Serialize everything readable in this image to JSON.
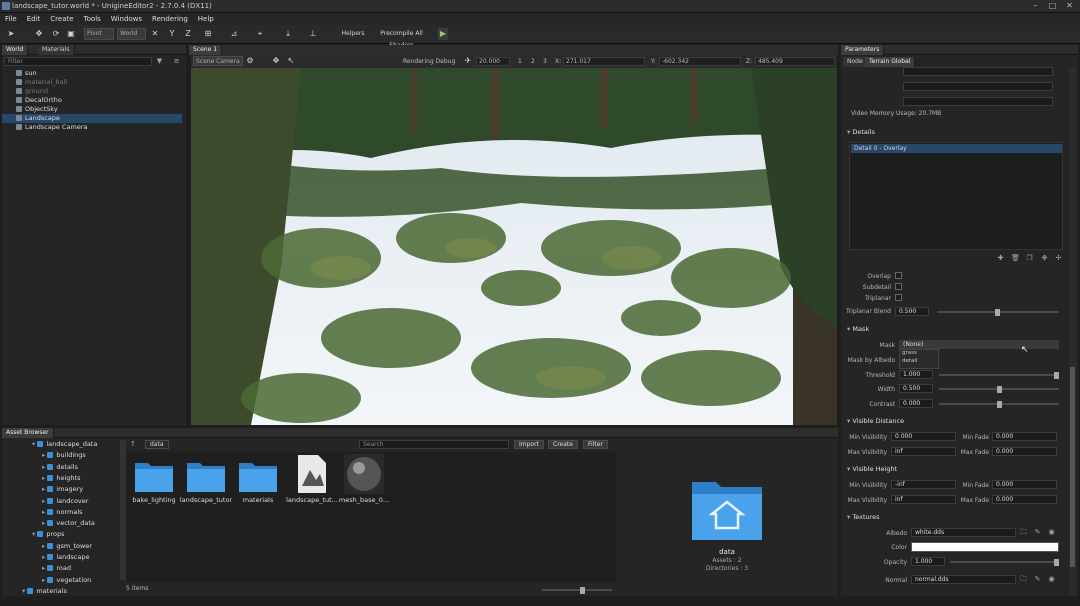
{
  "window": {
    "title": "landscape_tutor.world * - UnigineEditor2 - 2.7.0.4 (DX11)"
  },
  "menu": [
    "File",
    "Edit",
    "Create",
    "Tools",
    "Windows",
    "Rendering",
    "Help"
  ],
  "toolbar": {
    "pivot": "Pivot",
    "world": "World",
    "helpers": "Helpers",
    "precompile": "Precompile All Shaders"
  },
  "world_panel": {
    "tabs": [
      "World",
      "Materials"
    ],
    "filter_placeholder": "Filter",
    "nodes": [
      {
        "label": "sun",
        "dim": false
      },
      {
        "label": "material_ball",
        "dim": true
      },
      {
        "label": "ground",
        "dim": true
      },
      {
        "label": "DecalOrtho",
        "dim": false
      },
      {
        "label": "ObjectSky",
        "dim": false
      },
      {
        "label": "Landscape",
        "dim": false,
        "selected": true
      },
      {
        "label": "Landscape Camera",
        "dim": false
      }
    ]
  },
  "scene": {
    "tab": "Scene 1",
    "camera": "Scene Camera",
    "rendering_debug": "Rendering Debug",
    "speed": "20.000",
    "steps": [
      "1",
      "2",
      "3"
    ],
    "x_label": "X:",
    "x": "271.017",
    "y_label": "Y:",
    "y": "-602.342",
    "z_label": "Z:",
    "z": "485.409"
  },
  "asset_browser": {
    "tab": "Asset Browser",
    "tree": [
      {
        "label": "landscape_data",
        "level": 1
      },
      {
        "label": "buildings",
        "level": 2
      },
      {
        "label": "details",
        "level": 2
      },
      {
        "label": "heights",
        "level": 2
      },
      {
        "label": "imagery",
        "level": 2
      },
      {
        "label": "landcover",
        "level": 2
      },
      {
        "label": "normals",
        "level": 2
      },
      {
        "label": "vector_data",
        "level": 2
      },
      {
        "label": "props",
        "level": 1
      },
      {
        "label": "gsm_tower",
        "level": 2
      },
      {
        "label": "landscape",
        "level": 2
      },
      {
        "label": "road",
        "level": 2
      },
      {
        "label": "vegetation",
        "level": 2
      },
      {
        "label": "materials",
        "level": 0
      }
    ],
    "path": "data",
    "search_placeholder": "Search",
    "import": "Import",
    "create": "Create",
    "filter": "Filter",
    "items": [
      "bake_lighting",
      "landscape_tutor",
      "materials",
      "landscape_tut...",
      "mesh_base_0..."
    ],
    "count": "5 items",
    "info": {
      "name": "data",
      "assets": "Assets : 2",
      "directories": "Directories : 3"
    }
  },
  "params": {
    "tab": "Parameters",
    "subtabs": [
      "Node",
      "Terrain Global"
    ],
    "video_memory": "Video Memory Usage: 20.7MB",
    "details_header": "Details",
    "detail_item": "Detail 0 - Overlay",
    "overlap": "Overlap",
    "subdetail": "Subdetail",
    "triplanar": "Triplanar",
    "triplanar_blend": "Triplanar Blend",
    "triplanar_blend_val": "0.500",
    "mask_header": "Mask",
    "mask_label": "Mask",
    "mask_value": "(None)",
    "mask_options": [
      "grass",
      "detail"
    ],
    "mask_by_albedo": "Mask by Albedo",
    "threshold": "Threshold",
    "threshold_val": "1.000",
    "width": "Width",
    "width_val": "0.500",
    "contrast": "Contrast",
    "contrast_val": "0.000",
    "visible_distance": "Visible Distance",
    "min_visibility": "Min Visibility",
    "min_visibility_val": "0.000",
    "max_visibility": "Max Visibility",
    "max_visibility_val": "inf",
    "min_fade": "Min Fade",
    "min_fade_val": "0.000",
    "max_fade": "Max Fade",
    "max_fade_val": "0.000",
    "visible_height": "Visible Height",
    "h_min_visibility_val": "-inf",
    "h_max_visibility_val": "inf",
    "h_min_fade_val": "0.000",
    "h_max_fade_val": "0.000",
    "textures": "Textures",
    "albedo": "Albedo",
    "albedo_file": "white.dds",
    "color": "Color",
    "color_hex": "#ffffff",
    "opacity": "Opacity",
    "opacity_val": "1.000",
    "normal": "Normal",
    "normal_file": "normal.dds"
  }
}
